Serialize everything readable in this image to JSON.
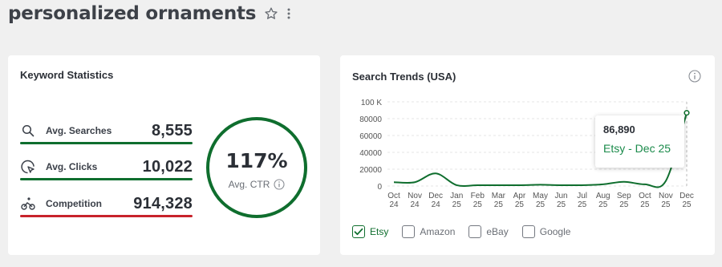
{
  "header": {
    "title": "personalized ornaments",
    "star_icon": "star-outline-icon",
    "menu_icon": "vertical-dots-icon"
  },
  "keyword_stats": {
    "title": "Keyword Statistics",
    "rows": [
      {
        "icon": "search-icon",
        "label": "Avg. Searches",
        "value": "8,555",
        "bar_color": "#0f6e2e"
      },
      {
        "icon": "pointer-click-icon",
        "label": "Avg. Clicks",
        "value": "10,022",
        "bar_color": "#0f6e2e"
      },
      {
        "icon": "competition-icon",
        "label": "Competition",
        "value": "914,328",
        "bar_color": "#c8232b"
      }
    ],
    "ctr": {
      "value": "117%",
      "label": "Avg. CTR",
      "info_icon": "info-icon"
    }
  },
  "search_trends": {
    "title": "Search Trends (USA)",
    "info_icon": "info-icon",
    "tooltip": {
      "value": "86,890",
      "label": "Etsy - Dec 25"
    },
    "legend": [
      {
        "label": "Etsy",
        "checked": true
      },
      {
        "label": "Amazon",
        "checked": false
      },
      {
        "label": "eBay",
        "checked": false
      },
      {
        "label": "Google",
        "checked": false
      }
    ]
  },
  "colors": {
    "accent": "#0f6e2e",
    "danger": "#c8232b",
    "tooltip_text": "#1a8a4a"
  },
  "chart_data": {
    "type": "line",
    "title": "Search Trends (USA)",
    "xlabel": "",
    "ylabel": "",
    "ylim": [
      0,
      100000
    ],
    "y_ticks": [
      "0",
      "20000",
      "40000",
      "60000",
      "80000",
      "100 K"
    ],
    "y_tick_values": [
      0,
      20000,
      40000,
      60000,
      80000,
      100000
    ],
    "categories": [
      "Oct 24",
      "Nov 24",
      "Dec 24",
      "Jan 25",
      "Feb 25",
      "Mar 25",
      "Apr 25",
      "May 25",
      "Jun 25",
      "Jul 25",
      "Aug 25",
      "Sep 25",
      "Oct 25",
      "Nov 25",
      "Dec 25"
    ],
    "category_lines": [
      [
        "Oct",
        "24"
      ],
      [
        "Nov",
        "24"
      ],
      [
        "Dec",
        "24"
      ],
      [
        "Jan",
        "25"
      ],
      [
        "Feb",
        "25"
      ],
      [
        "Mar",
        "25"
      ],
      [
        "Apr",
        "25"
      ],
      [
        "May",
        "25"
      ],
      [
        "Jun",
        "25"
      ],
      [
        "Jul",
        "25"
      ],
      [
        "Aug",
        "25"
      ],
      [
        "Sep",
        "25"
      ],
      [
        "Oct",
        "25"
      ],
      [
        "Nov",
        "25"
      ],
      [
        "Dec",
        "25"
      ]
    ],
    "series": [
      {
        "name": "Etsy",
        "color": "#0f6e2e",
        "values": [
          4500,
          4500,
          15000,
          1000,
          1000,
          1000,
          1000,
          1500,
          1000,
          1000,
          2000,
          5000,
          2000,
          6000,
          86890
        ]
      }
    ],
    "grid": true
  }
}
